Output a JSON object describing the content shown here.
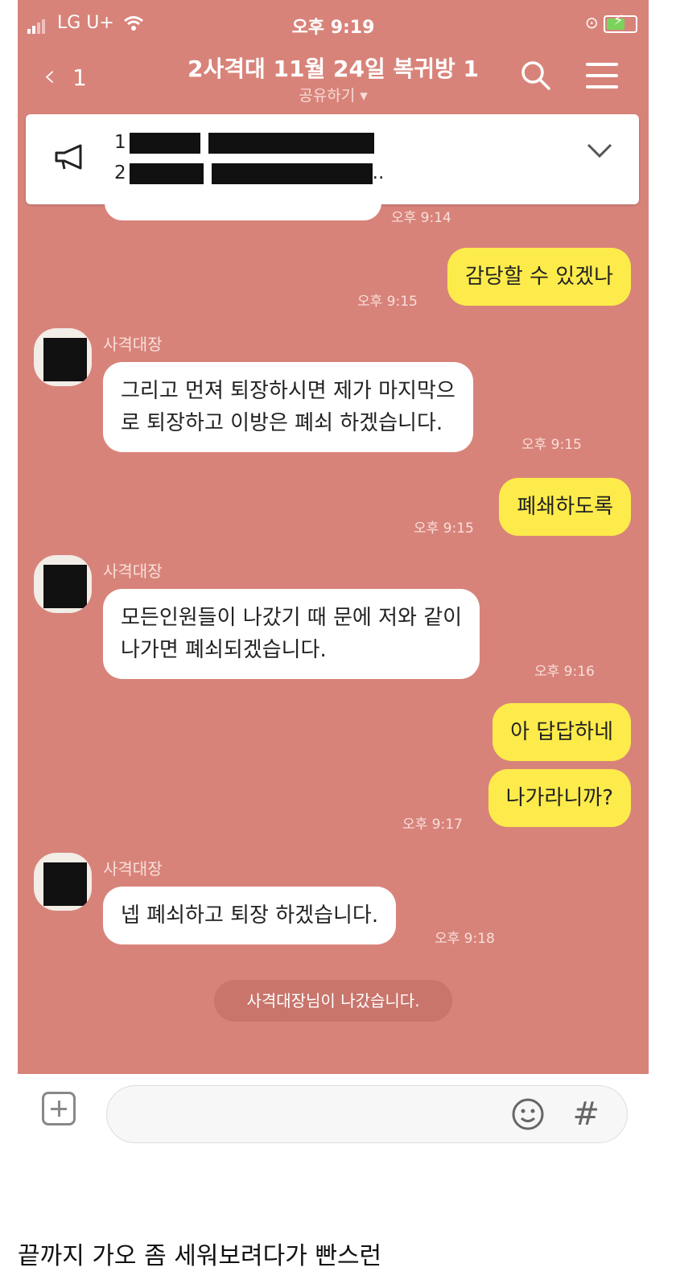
{
  "status_bar": {
    "carrier": "LG U+",
    "time": "오후 9:19"
  },
  "header": {
    "back_count": "1",
    "title": "2사격대 11월 24일 복귀방 1",
    "subtitle": "공유하기 ▾"
  },
  "notice": {
    "line1_prefix": "1",
    "line2_prefix": "2",
    "line2_suffix": ".."
  },
  "messages": [
    {
      "side": "them-partial",
      "time": "오후 9:14"
    },
    {
      "side": "me",
      "text": "감당할 수 있겠나",
      "time": "오후 9:15"
    },
    {
      "side": "them",
      "sender": "사격대장",
      "text": "그리고 먼져 퇴장하시면 제가 마지막으\n로 퇴장하고 이방은 폐쇠 하겠습니다.",
      "time": "오후 9:15"
    },
    {
      "side": "me",
      "text": "폐쇄하도록",
      "time": "오후 9:15"
    },
    {
      "side": "them",
      "sender": "사격대장",
      "text": "모든인원들이 나갔기 때 문에  저와 같이\n나가면 폐쇠되겠습니다.",
      "time": "오후 9:16"
    },
    {
      "side": "me",
      "text": "아 답답하네",
      "time": ""
    },
    {
      "side": "me",
      "text": "나가라니까?",
      "time": "오후 9:17"
    },
    {
      "side": "them",
      "sender": "사격대장",
      "text": "넵 폐쇠하고 퇴장 하겠습니다.",
      "time": "오후 9:18"
    }
  ],
  "system_message": "사격대장님이 나갔습니다.",
  "input": {
    "placeholder": "",
    "hash_label": "#"
  },
  "caption": "끝까지 가오 좀 세워보려다가 빤스런",
  "colors": {
    "background": "#d8837a",
    "my_bubble": "#fdeb4b",
    "their_bubble": "#ffffff"
  }
}
